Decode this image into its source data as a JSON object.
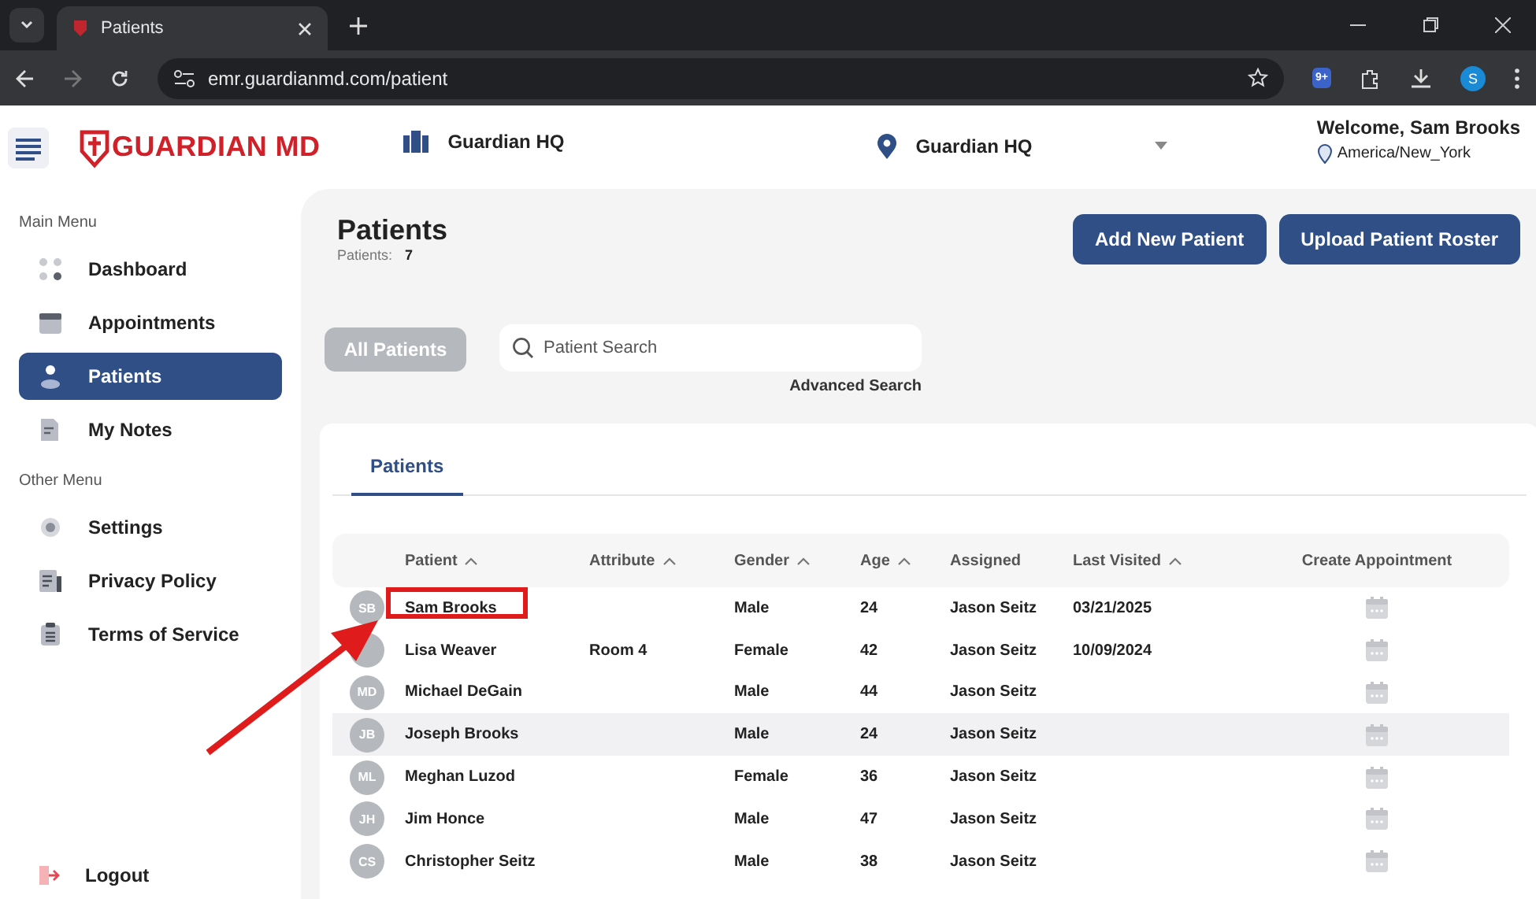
{
  "browser": {
    "tab_title": "Patients",
    "url": "emr.guardianmd.com/patient",
    "profile_initial": "S",
    "extension_badge": "9+"
  },
  "header": {
    "logo": "GUARDIAN MD",
    "organization": "Guardian HQ",
    "location": "Guardian HQ",
    "welcome": "Welcome, Sam Brooks",
    "timezone": "America/New_York"
  },
  "sidebar": {
    "sections": [
      {
        "heading": "Main Menu",
        "items": [
          {
            "label": "Dashboard",
            "selected": false
          },
          {
            "label": "Appointments",
            "selected": false
          },
          {
            "label": "Patients",
            "selected": true
          },
          {
            "label": "My Notes",
            "selected": false
          }
        ]
      },
      {
        "heading": "Other Menu",
        "items": [
          {
            "label": "Settings",
            "selected": false
          },
          {
            "label": "Privacy Policy",
            "selected": false
          },
          {
            "label": "Terms of Service",
            "selected": false
          }
        ]
      }
    ],
    "logout": "Logout"
  },
  "page": {
    "title": "Patients",
    "count_label": "Patients:",
    "count": "7",
    "buttons": [
      "Add New Patient",
      "Upload Patient Roster"
    ],
    "filter_button": "All Patients",
    "search": {
      "placeholder": "Patient Search"
    },
    "advanced_search": "Advanced Search"
  },
  "tabs": [
    {
      "label": "Patients",
      "selected": true
    }
  ],
  "table": {
    "columns": [
      {
        "label": "Patient",
        "sortable": true
      },
      {
        "label": "Attribute",
        "sortable": true
      },
      {
        "label": "Gender",
        "sortable": true
      },
      {
        "label": "Age",
        "sortable": true
      },
      {
        "label": "Assigned",
        "sortable": false
      },
      {
        "label": "Last Visited",
        "sortable": true
      },
      {
        "label": "Create Appointment",
        "sortable": false
      }
    ],
    "rows": [
      {
        "initials": "SB",
        "patient": "Sam Brooks",
        "attribute": "",
        "gender": "Male",
        "age": "24",
        "assigned": "Jason Seitz",
        "last_visited": "03/21/2025",
        "highlighted": false
      },
      {
        "patient": "Lisa Weaver",
        "attribute": "Room 4",
        "gender": "Female",
        "age": "42",
        "assigned": "Jason Seitz",
        "last_visited": "10/09/2024",
        "highlighted": false
      },
      {
        "initials": "MD",
        "patient": "Michael DeGain",
        "gender": "Male",
        "age": "44",
        "assigned": "Jason Seitz",
        "highlighted": false
      },
      {
        "initials": "JB",
        "patient": "Joseph Brooks",
        "gender": "Male",
        "age": "24",
        "assigned": "Jason Seitz",
        "highlighted": true
      },
      {
        "initials": "ML",
        "patient": "Meghan Luzod",
        "gender": "Female",
        "age": "36",
        "assigned": "Jason Seitz",
        "highlighted": false
      },
      {
        "initials": "JH",
        "patient": "Jim Honce",
        "gender": "Male",
        "age": "47",
        "assigned": "Jason Seitz",
        "highlighted": false
      },
      {
        "initials": "CS",
        "patient": "Christopher Seitz",
        "gender": "Male",
        "age": "38",
        "assigned": "Jason Seitz",
        "highlighted": false
      }
    ]
  }
}
